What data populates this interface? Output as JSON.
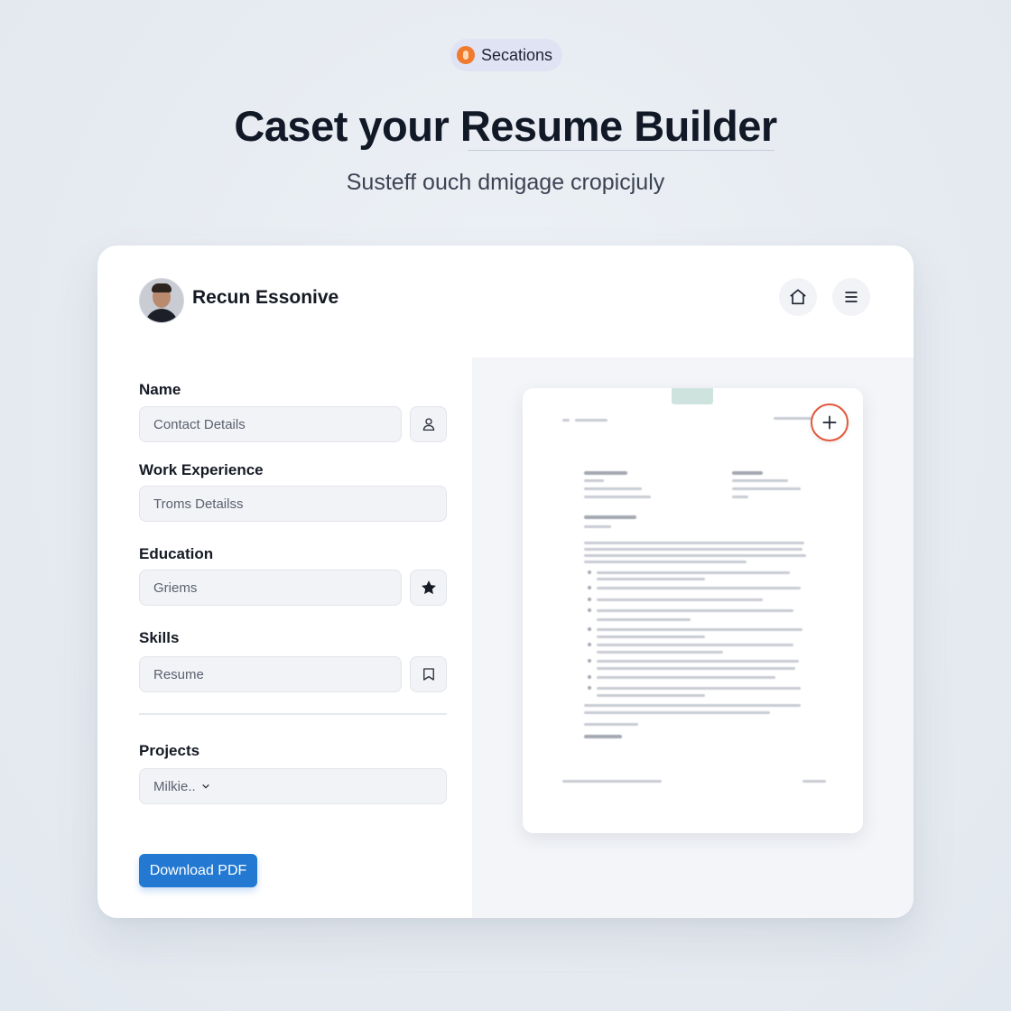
{
  "badge": {
    "label": "Secations",
    "icon": "badge-icon",
    "accent": "#f07a2e"
  },
  "hero": {
    "title": "Caset your Resume Builder",
    "subtitle": "Susteff ouch dmigage cropicjuly"
  },
  "card": {
    "profile_name": "Recun Essonive",
    "header_icons": [
      "home-icon",
      "menu-icon"
    ]
  },
  "form": {
    "name_label": "Name",
    "name_value": "Contact Details",
    "work_label": "Work Experience",
    "work_value": "Troms Detailss",
    "education_label": "Education",
    "education_value": "Griems",
    "skills_label": "Skills",
    "skills_value": "Resume",
    "projects_label": "Projects",
    "projects_value": "Milkie..",
    "download_label": "Download PDF",
    "accent": "#2379d2"
  },
  "preview": {
    "add_icon": "plus-icon",
    "add_accent": "#e2573a"
  }
}
